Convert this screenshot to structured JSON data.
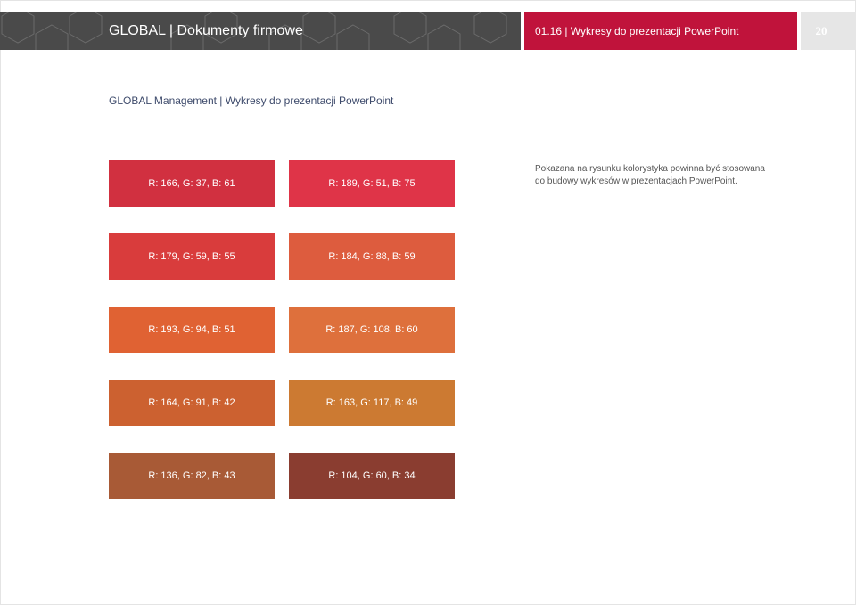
{
  "header": {
    "title": "GLOBAL | Dokumenty firmowe",
    "subtitle": "01.16 | Wykresy do prezentacji PowerPoint",
    "page_number": "20",
    "colors": {
      "dark": "#4a4a4a",
      "accent": "#c0133b",
      "page_box": "#e6e6e6"
    }
  },
  "section_title": "GLOBAL Management | Wykresy do prezentacji PowerPoint",
  "note": {
    "line1": "Pokazana na rysunku kolorystyka powinna być stosowana",
    "line2": "do budowy wykresów w prezentacjach PowerPoint."
  },
  "swatches": [
    {
      "label": "R: 166, G: 37, B: 61",
      "color": "#d13040"
    },
    {
      "label": "R: 189, G: 51, B: 75",
      "color": "#df3448"
    },
    {
      "label": "R: 179, G: 59, B: 55",
      "color": "#d93c3c"
    },
    {
      "label": "R: 184, G: 88, B: 59",
      "color": "#dd5c3e"
    },
    {
      "label": "R: 193, G: 94, B: 51",
      "color": "#e06233"
    },
    {
      "label": "R: 187, G: 108, B: 60",
      "color": "#de703c"
    },
    {
      "label": "R: 164, G: 91, B: 42",
      "color": "#cc6130"
    },
    {
      "label": "R: 163, G: 117, B: 49",
      "color": "#cc7a32"
    },
    {
      "label": "R: 136, G: 82, B: 43",
      "color": "#a85a36"
    },
    {
      "label": "R: 104, G: 60, B: 34",
      "color": "#8a3d30"
    }
  ]
}
